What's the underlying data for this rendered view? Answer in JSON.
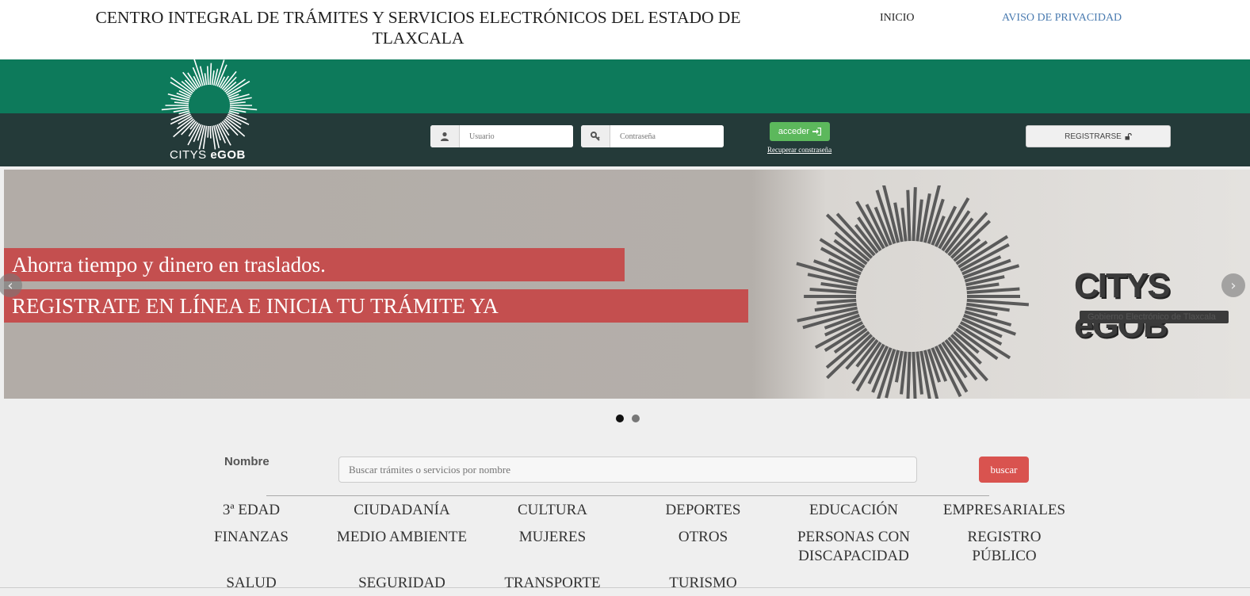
{
  "header": {
    "title": "CENTRO INTEGRAL DE TRÁMITES Y SERVICIOS ELECTRÓNICOS DEL ESTADO DE TLAXCALA",
    "nav": [
      {
        "label": "INICIO"
      },
      {
        "label": "AVISO DE PRIVACIDAD"
      }
    ]
  },
  "logo": {
    "text_light": "CITYS ",
    "text_bold": "eGOB"
  },
  "login": {
    "user_placeholder": "Usuario",
    "pass_placeholder": "Contraseña",
    "user_icon": "user-icon",
    "pass_icon": "key-icon",
    "submit_label": "acceder",
    "submit_icon": "sign-in-icon",
    "recover_label": "Recuperar constraseña",
    "register_label": "REGISTRARSE",
    "register_icon": "unlock-icon"
  },
  "carousel": {
    "caption_1": "Ahorra tiempo y dinero en traslados.",
    "caption_2": "REGISTRATE EN LÍNEA E INICIA TU TRÁMITE YA",
    "brand_text": "CITYS eGOB",
    "brand_sub": "Gobierno Electrónico de Tlaxcala",
    "slides": 2,
    "active_slide": 1
  },
  "search": {
    "label": "Nombre",
    "placeholder": "Buscar trámites o servicios por nombre",
    "button_label": "buscar"
  },
  "categories": [
    "3ª EDAD",
    "CIUDADANÍA",
    "CULTURA",
    "DEPORTES",
    "EDUCACIÓN",
    "EMPRESARIALES",
    "FINANZAS",
    "MEDIO AMBIENTE",
    "MUJERES",
    "OTROS",
    "PERSONAS CON DISCAPACIDAD",
    "REGISTRO PÚBLICO",
    "SALUD",
    "SEGURIDAD",
    "TRANSPORTE",
    "TURISMO"
  ],
  "colors": {
    "green_band": "#0d7a5b",
    "dark_band": "#243a39",
    "caption_red": "#c44f4f",
    "acceder_green": "#5cb85c",
    "buscar_red": "#d9534f",
    "link_blue": "#4a7bb0"
  }
}
